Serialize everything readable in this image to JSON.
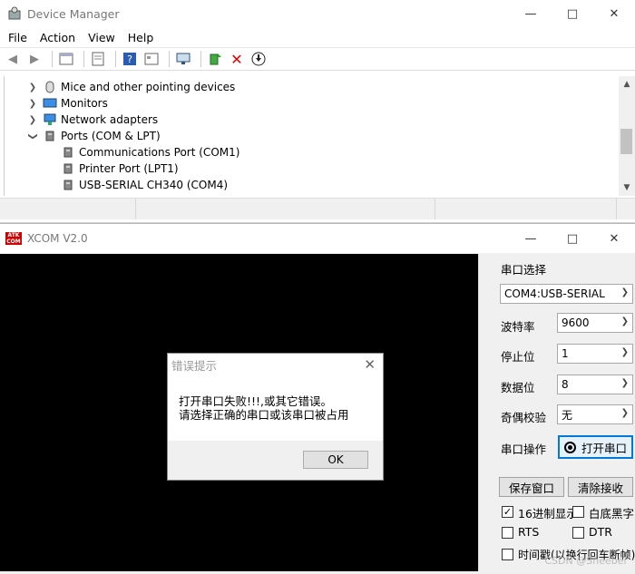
{
  "device_manager": {
    "title": "Device Manager",
    "menu": [
      "File",
      "Action",
      "View",
      "Help"
    ],
    "tree": [
      {
        "label": "Mice and other pointing devices",
        "expanded": false,
        "level": 1,
        "icon": "mouse-icon"
      },
      {
        "label": "Monitors",
        "expanded": false,
        "level": 1,
        "icon": "monitor-icon"
      },
      {
        "label": "Network adapters",
        "expanded": false,
        "level": 1,
        "icon": "network-icon"
      },
      {
        "label": "Ports (COM & LPT)",
        "expanded": true,
        "level": 1,
        "icon": "port-icon"
      },
      {
        "label": "Communications Port (COM1)",
        "level": 2,
        "icon": "port-icon"
      },
      {
        "label": "Printer Port (LPT1)",
        "level": 2,
        "icon": "port-icon"
      },
      {
        "label": "USB-SERIAL CH340 (COM4)",
        "level": 2,
        "icon": "port-icon"
      }
    ]
  },
  "xcom": {
    "title": "XCOM V2.0",
    "logo_text": "ATK",
    "serial_select_label": "串口选择",
    "serial_port_value": "COM4:USB-SERIAL",
    "baud_label": "波特率",
    "baud_value": "9600",
    "stop_label": "停止位",
    "stop_value": "1",
    "data_label": "数据位",
    "data_value": "8",
    "parity_label": "奇偶校验",
    "parity_value": "无",
    "operate_label": "串口操作",
    "open_button": "打开串口",
    "save_button": "保存窗口",
    "clear_button": "清除接收",
    "hex_display": "16进制显示",
    "white_bg": "白底黑字",
    "rts": "RTS",
    "dtr": "DTR",
    "timestamp": "时间戳(以换行回车断帧)"
  },
  "dialog": {
    "title": "错误提示",
    "line1": "打开串口失败!!!,或其它错误。",
    "line2": "请选择正确的串口或该串口被占用",
    "ok": "OK"
  },
  "watermark": "CSDN @Sneeber",
  "colors": {
    "accent": "#c00000",
    "terminal": "#000000"
  }
}
